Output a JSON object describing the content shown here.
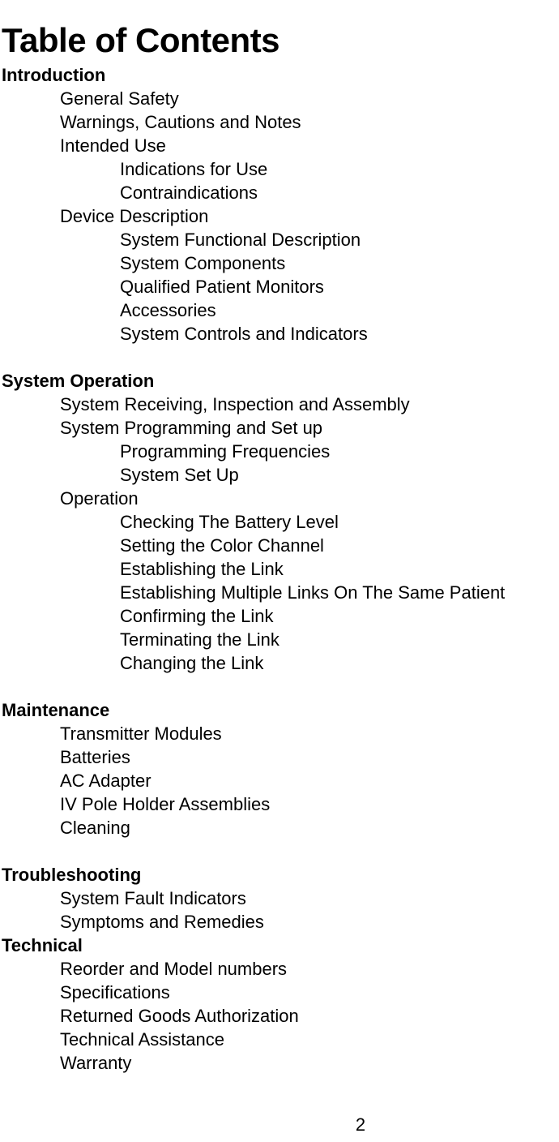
{
  "document": {
    "title": "Table of Contents",
    "page_number": "2"
  },
  "toc": {
    "entries": [
      {
        "level": 0,
        "text": "Introduction"
      },
      {
        "level": 1,
        "text": "General Safety"
      },
      {
        "level": 1,
        "text": "Warnings, Cautions and Notes"
      },
      {
        "level": 1,
        "text": "Intended Use"
      },
      {
        "level": 2,
        "text": "Indications for Use"
      },
      {
        "level": 2,
        "text": "Contraindications"
      },
      {
        "level": 1,
        "text": "Device Description"
      },
      {
        "level": 2,
        "text": "System Functional Description"
      },
      {
        "level": 2,
        "text": "System Components"
      },
      {
        "level": 2,
        "text": "Qualified Patient Monitors"
      },
      {
        "level": 2,
        "text": "Accessories"
      },
      {
        "level": 2,
        "text": "System Controls and Indicators"
      },
      {
        "level": -1,
        "text": ""
      },
      {
        "level": 0,
        "text": "System Operation"
      },
      {
        "level": 1,
        "text": "System Receiving, Inspection and Assembly"
      },
      {
        "level": 1,
        "text": "System Programming and Set up"
      },
      {
        "level": 2,
        "text": "Programming Frequencies"
      },
      {
        "level": 2,
        "text": "System Set Up"
      },
      {
        "level": 1,
        "text": "Operation"
      },
      {
        "level": 2,
        "text": "Checking The Battery Level"
      },
      {
        "level": 2,
        "text": "Setting the Color Channel"
      },
      {
        "level": 2,
        "text": "Establishing the Link"
      },
      {
        "level": 2,
        "text": "Establishing Multiple Links On The Same Patient"
      },
      {
        "level": 2,
        "text": "Confirming the Link"
      },
      {
        "level": 2,
        "text": "Terminating the Link"
      },
      {
        "level": 2,
        "text": "Changing the Link"
      },
      {
        "level": -1,
        "text": ""
      },
      {
        "level": 0,
        "text": "Maintenance"
      },
      {
        "level": 1,
        "text": "Transmitter Modules"
      },
      {
        "level": 1,
        "text": "Batteries"
      },
      {
        "level": 1,
        "text": "AC Adapter"
      },
      {
        "level": 1,
        "text": "IV Pole Holder Assemblies"
      },
      {
        "level": 1,
        "text": "Cleaning"
      },
      {
        "level": -1,
        "text": ""
      },
      {
        "level": 0,
        "text": "Troubleshooting"
      },
      {
        "level": 1,
        "text": "System Fault Indicators"
      },
      {
        "level": 1,
        "text": "Symptoms and Remedies"
      },
      {
        "level": 0,
        "text": "Technical"
      },
      {
        "level": 1,
        "text": "Reorder and  Model numbers"
      },
      {
        "level": 1,
        "text": "Specifications"
      },
      {
        "level": 1,
        "text": "Returned Goods Authorization"
      },
      {
        "level": 1,
        "text": "Technical Assistance"
      },
      {
        "level": 1,
        "text": "Warranty"
      }
    ]
  }
}
